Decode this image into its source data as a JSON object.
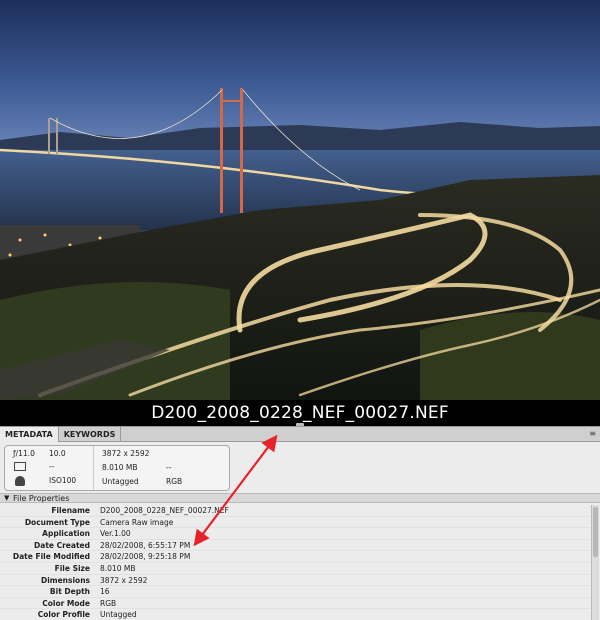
{
  "photo": {
    "filename": "D200_2008_0228_NEF_00027.NEF"
  },
  "tabs": [
    {
      "label": "METADATA"
    },
    {
      "label": "KEYWORDS"
    }
  ],
  "panel_menu": "≡",
  "summary": {
    "aperture": "ƒ/11.0",
    "aperture_val": "10.0",
    "metering": "--",
    "iso": "ISO100",
    "dimensions": "3872 x 2592",
    "size": "8.010 MB",
    "dpi": "--",
    "profile": "Untagged",
    "mode": "RGB"
  },
  "section": {
    "title": "File Properties"
  },
  "properties": [
    {
      "key": "Filename",
      "value": "D200_2008_0228_NEF_00027.NEF"
    },
    {
      "key": "Document Type",
      "value": "Camera Raw image"
    },
    {
      "key": "Application",
      "value": "Ver.1.00"
    },
    {
      "key": "Date Created",
      "value": "28/02/2008, 6:55:17 PM"
    },
    {
      "key": "Date File Modified",
      "value": "28/02/2008, 9:25:18 PM"
    },
    {
      "key": "File Size",
      "value": "8.010 MB"
    },
    {
      "key": "Dimensions",
      "value": "3872 x 2592"
    },
    {
      "key": "Bit Depth",
      "value": "16"
    },
    {
      "key": "Color Mode",
      "value": "RGB"
    },
    {
      "key": "Color Profile",
      "value": "Untagged"
    }
  ],
  "colors": {
    "arrow": "#e8222a",
    "panel": "#ececec",
    "tabbar": "#cfcfcf"
  }
}
